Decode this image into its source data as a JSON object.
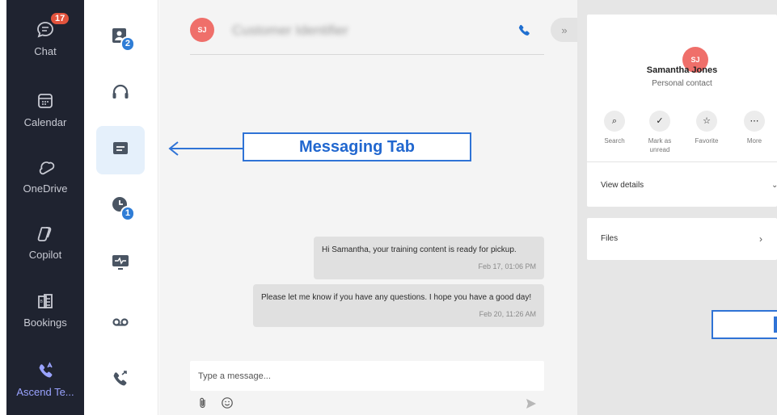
{
  "rail": {
    "items": [
      {
        "label": "Chat",
        "icon": "chat-icon",
        "badge": "17"
      },
      {
        "label": "Calendar",
        "icon": "calendar-icon"
      },
      {
        "label": "OneDrive",
        "icon": "onedrive-icon"
      },
      {
        "label": "Copilot",
        "icon": "copilot-icon"
      },
      {
        "label": "Bookings",
        "icon": "bookings-icon"
      },
      {
        "label": "Ascend Te...",
        "icon": "phone-app-icon"
      }
    ]
  },
  "col2": {
    "contacts_badge": "2",
    "history_badge": "1"
  },
  "header": {
    "avatar_initials": "SJ",
    "contact_name": "Customer Identifier"
  },
  "messages": [
    {
      "text": "Hi Samantha, your training content is ready for pickup.",
      "time": "Feb 17, 01:06 PM"
    },
    {
      "text": "Please let me know if you have any questions. I hope you have a good day!",
      "time": "Feb 20, 11:26 AM"
    }
  ],
  "composer": {
    "placeholder": "Type a message..."
  },
  "callout": {
    "label": "Messaging Tab"
  },
  "contact_card": {
    "avatar_initials": "SJ",
    "name": "Samantha Jones",
    "subtitle": "Personal contact",
    "actions": [
      {
        "label": "Search",
        "icon": "search-icon"
      },
      {
        "label": "Mark as unread",
        "icon": "mark-unread-icon"
      },
      {
        "label": "Favorite",
        "icon": "star-icon"
      },
      {
        "label": "More",
        "icon": "more-icon"
      }
    ],
    "view_details": "View details",
    "files": "Files"
  },
  "colors": {
    "accent": "#2f73d6",
    "avatar": "#ef6f6a",
    "rail": "#1f2330"
  }
}
